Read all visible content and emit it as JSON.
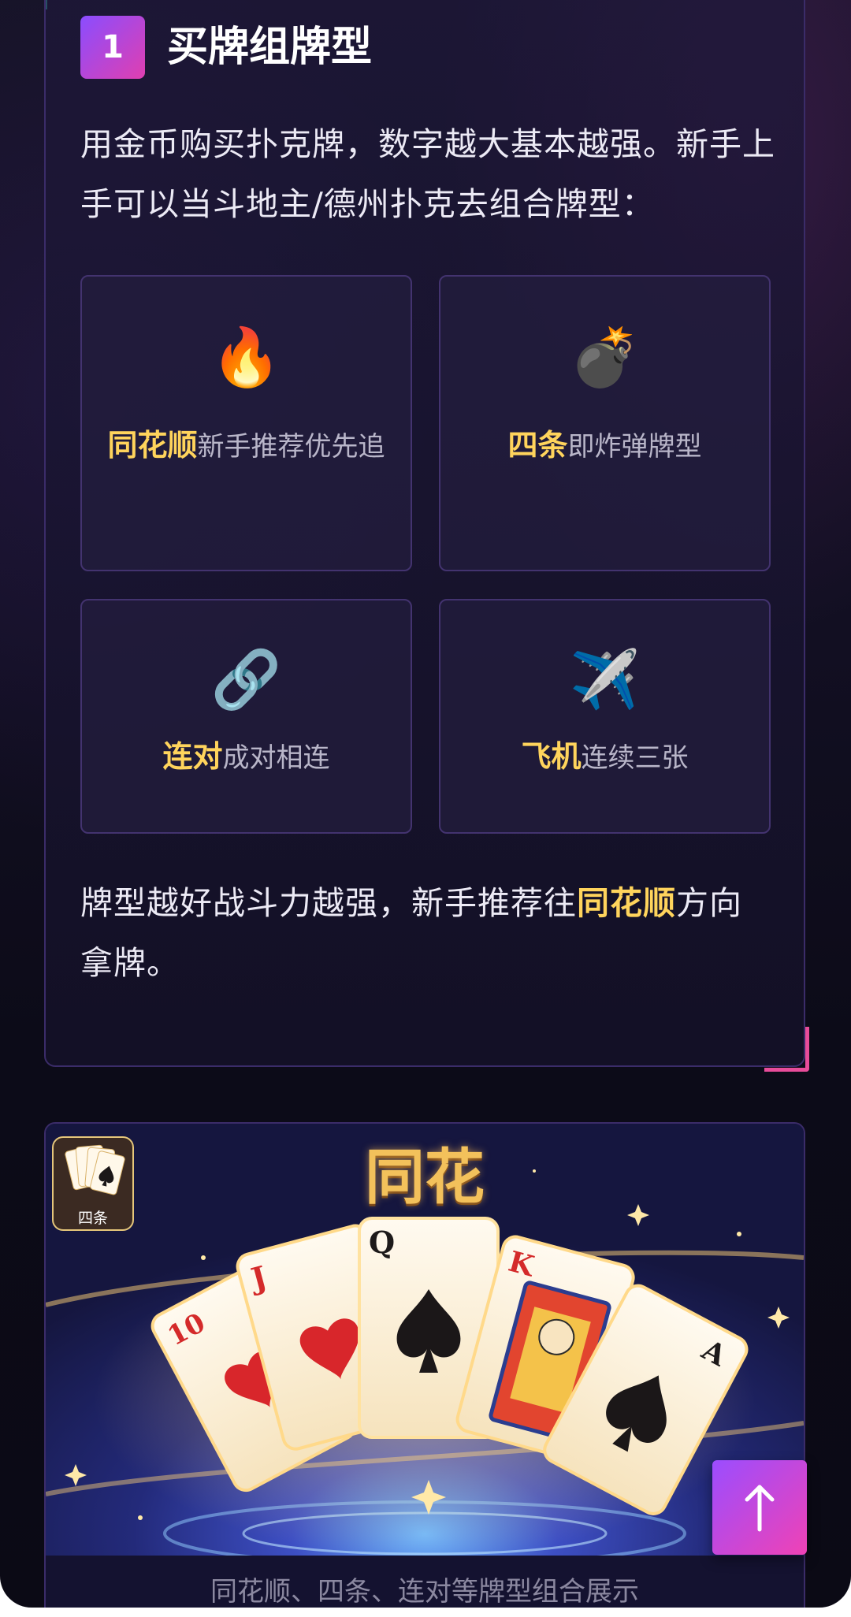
{
  "section": {
    "step_number": "1",
    "title": "买牌组牌型",
    "intro": "用金币购买扑克牌，数字越大基本越强。新手上手可以当斗地主/德州扑克去组合牌型："
  },
  "tiles": [
    {
      "icon": "fire-icon",
      "emoji": "🔥",
      "name": "同花顺",
      "desc": "新手推荐优先追"
    },
    {
      "icon": "bomb-icon",
      "emoji": "💣",
      "name": "四条",
      "desc": "即炸弹牌型"
    },
    {
      "icon": "link-icon",
      "emoji": "🔗",
      "name": "连对",
      "desc": "成对相连"
    },
    {
      "icon": "airplane-icon",
      "emoji": "✈️",
      "name": "飞机",
      "desc": "连续三张"
    }
  ],
  "summary": {
    "before": "牌型越好战斗力越强，新手推荐往",
    "highlight": "同花顺",
    "after": "方向拿牌。"
  },
  "image_card": {
    "art_title": "同花",
    "thumb_label": "四条",
    "cards": [
      "10",
      "J",
      "Q",
      "K",
      "A"
    ],
    "caption": "同花顺、四条、连对等牌型组合展示"
  },
  "scroll_top": {
    "icon": "arrow-up-icon"
  },
  "colors": {
    "accent_gold": "#ffd45c",
    "accent_pink": "#e84c9a",
    "accent_purple": "#8a4dff",
    "background": "#141129"
  }
}
